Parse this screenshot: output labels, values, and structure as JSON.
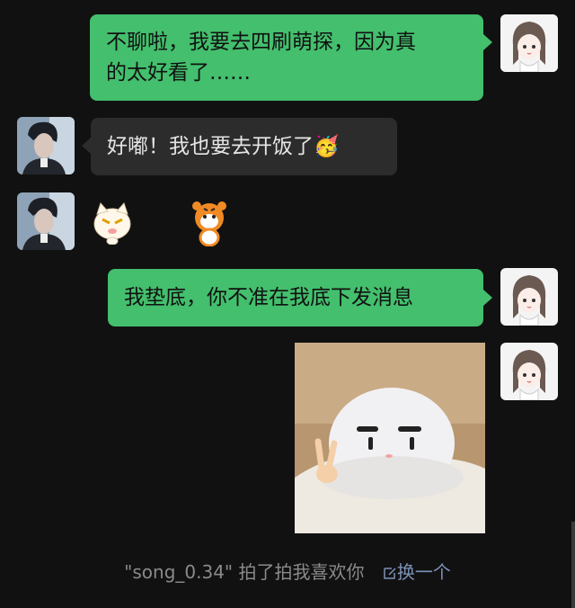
{
  "messages": [
    {
      "side": "right",
      "sender": "self",
      "text_line1": "不聊啦，我要去四刷萌探，因为真",
      "text_line2": "的太好看了……"
    },
    {
      "side": "left",
      "sender": "other",
      "text": "好嘟！我也要去开饭了",
      "emoji": "🥳"
    },
    {
      "side": "left",
      "sender": "other",
      "stickers": [
        "cat-sticker",
        "tiger-sticker"
      ]
    },
    {
      "side": "right",
      "sender": "self",
      "text": "我垫底，你不准在我底下发消息"
    },
    {
      "side": "right",
      "sender": "self",
      "image": "plush-dumpling-photo"
    }
  ],
  "system": {
    "pat_text": "\"song_0.34\" 拍了拍我喜欢你",
    "link_icon": "edit-icon",
    "link_text": "换一个"
  },
  "colors": {
    "background": "#111111",
    "self_bubble": "#43bf6d",
    "other_bubble": "#2c2c2c",
    "system_text": "#8a8a8a",
    "link": "#7d92b8"
  }
}
